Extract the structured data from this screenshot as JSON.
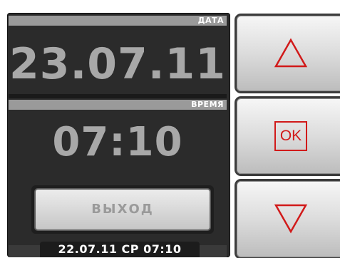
{
  "date": {
    "label": "ДАТА",
    "value": "23.07.11"
  },
  "time": {
    "label": "ВРЕМЯ",
    "value": "07:10"
  },
  "exit_label": "ВЫХОД",
  "status_line": "22.07.11  СР  07:10",
  "buttons": {
    "up_icon": "triangle-up-icon",
    "ok_label": "OK",
    "down_icon": "triangle-down-icon"
  },
  "colors": {
    "accent": "#d11a1a",
    "panel": "#2b2b2b",
    "value_text": "#a8a8a8"
  }
}
